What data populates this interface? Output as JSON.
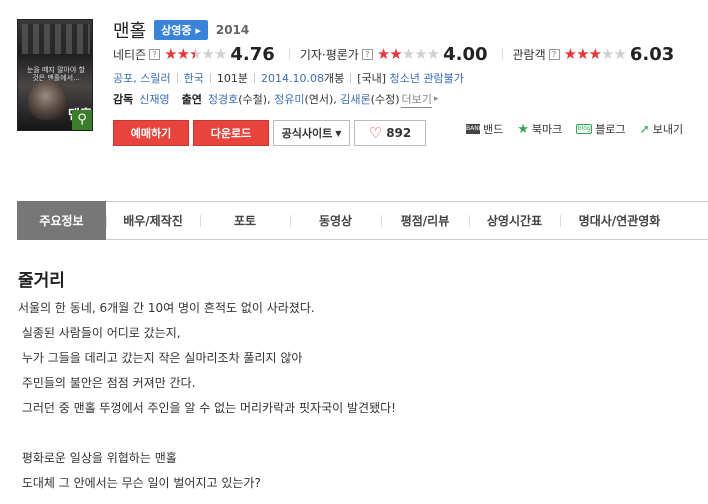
{
  "header": {
    "poster": {
      "tagline": "눈을 떼지 말아야 할 것은 맨홀에서...",
      "title": "맨홀"
    },
    "title": "맨홀",
    "status": "상영중",
    "year": "2014"
  },
  "ratings": [
    {
      "label": "네티즌",
      "score": "4.76",
      "filled": 2.5,
      "max": 5
    },
    {
      "label": "기자·평론가",
      "score": "4.00",
      "filled": 2,
      "max": 5
    },
    {
      "label": "관람객",
      "score": "6.03",
      "filled": 3,
      "max": 5
    }
  ],
  "meta": {
    "genre": "공포, 스릴러",
    "country": "한국",
    "runtime": "101분",
    "release": "2014.10.08",
    "release_suffix": " 개봉",
    "rating_prefix": "[국내]",
    "rating": "청소년 관람불가"
  },
  "credits": {
    "director_label": "감독",
    "director": "신재영",
    "cast_label": "출연",
    "cast": [
      {
        "name": "정경호",
        "role": "(수철)"
      },
      {
        "name": "정유미",
        "role": "(연서)"
      },
      {
        "name": "김새론",
        "role": "(수정)"
      }
    ],
    "more": "더보기"
  },
  "buttons": {
    "reserve": "예매하기",
    "download": "다운로드",
    "official": "공식사이트",
    "like_count": "892"
  },
  "share": [
    {
      "label": "밴드",
      "icon": "band-icon"
    },
    {
      "label": "북마크",
      "icon": "bookmark-star-icon"
    },
    {
      "label": "블로그",
      "icon": "blog-icon"
    },
    {
      "label": "보내기",
      "icon": "send-icon"
    }
  ],
  "tabs": [
    {
      "label": "주요정보",
      "active": true
    },
    {
      "label": "배우/제작진"
    },
    {
      "label": "포토"
    },
    {
      "label": "동영상"
    },
    {
      "label": "평점/리뷰"
    },
    {
      "label": "상영시간표"
    },
    {
      "label": "명대사/연관영화"
    }
  ],
  "synopsis": {
    "title": "줄거리",
    "lines": [
      "서울의 한 동네, 6개월 간 10여 명이 흔적도 없이 사라졌다.",
      " 실종된 사람들이 어디로 갔는지,",
      " 누가 그들을 데리고 갔는지 작은 실마리조차 풀리지 않아",
      " 주민들의 불안은 점점 커져만 간다.",
      " 그러던 중 맨홀 뚜껑에서 주인을 알 수 없는 머리카락과 핏자국이 발견됐다!",
      "",
      " 평화로운 일상을 위협하는 맨홀",
      " 도대체 그 안에서는 무슨 일이 벌어지고 있는가?"
    ]
  }
}
